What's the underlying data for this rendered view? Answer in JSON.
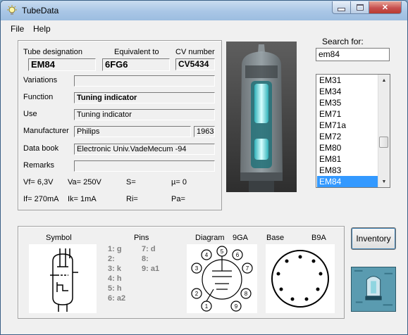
{
  "window": {
    "title": "TubeData"
  },
  "menu": {
    "file": "File",
    "help": "Help"
  },
  "details": {
    "designation_label": "Tube designation",
    "designation": "EM84",
    "equivalent_label": "Equivalent to",
    "equivalent": "6FG6",
    "cv_label": "CV number",
    "cv": "CV5434",
    "variations_label": "Variations",
    "variations": "",
    "function_label": "Function",
    "function": "Tuning indicator",
    "use_label": "Use",
    "use": "Tuning indicator",
    "manufacturer_label": "Manufacturer",
    "manufacturer": "Philips",
    "year": "1963",
    "databook_label": "Data book",
    "databook": "Electronic Univ.VadeMecum -94",
    "remarks_label": "Remarks",
    "remarks": ""
  },
  "params": {
    "vf": "Vf= 6,3V",
    "va": "Va=  250V",
    "s": "S=",
    "mu": "µ=    0",
    "if": "If= 270mA",
    "ik": "Ik=   1mA",
    "ri": "Ri=",
    "pa": "Pa="
  },
  "search": {
    "label": "Search for:",
    "value": "em84"
  },
  "tube_list": [
    "EM31",
    "EM34",
    "EM35",
    "EM71",
    "EM71a",
    "EM72",
    "EM80",
    "EM81",
    "EM83",
    "EM84"
  ],
  "selected_index": 9,
  "bottom": {
    "symbol_label": "Symbol",
    "pins_label": "Pins",
    "diagram_label": "Diagram",
    "diagram_code": "9GA",
    "base_label": "Base",
    "base_code": "B9A"
  },
  "pins_left": [
    "1: g",
    "2:",
    "3: k",
    "4: h",
    "5: h",
    "6: a2"
  ],
  "pins_right": [
    "7: d",
    "8:",
    "9: a1"
  ],
  "buttons": {
    "inventory": "Inventory"
  }
}
